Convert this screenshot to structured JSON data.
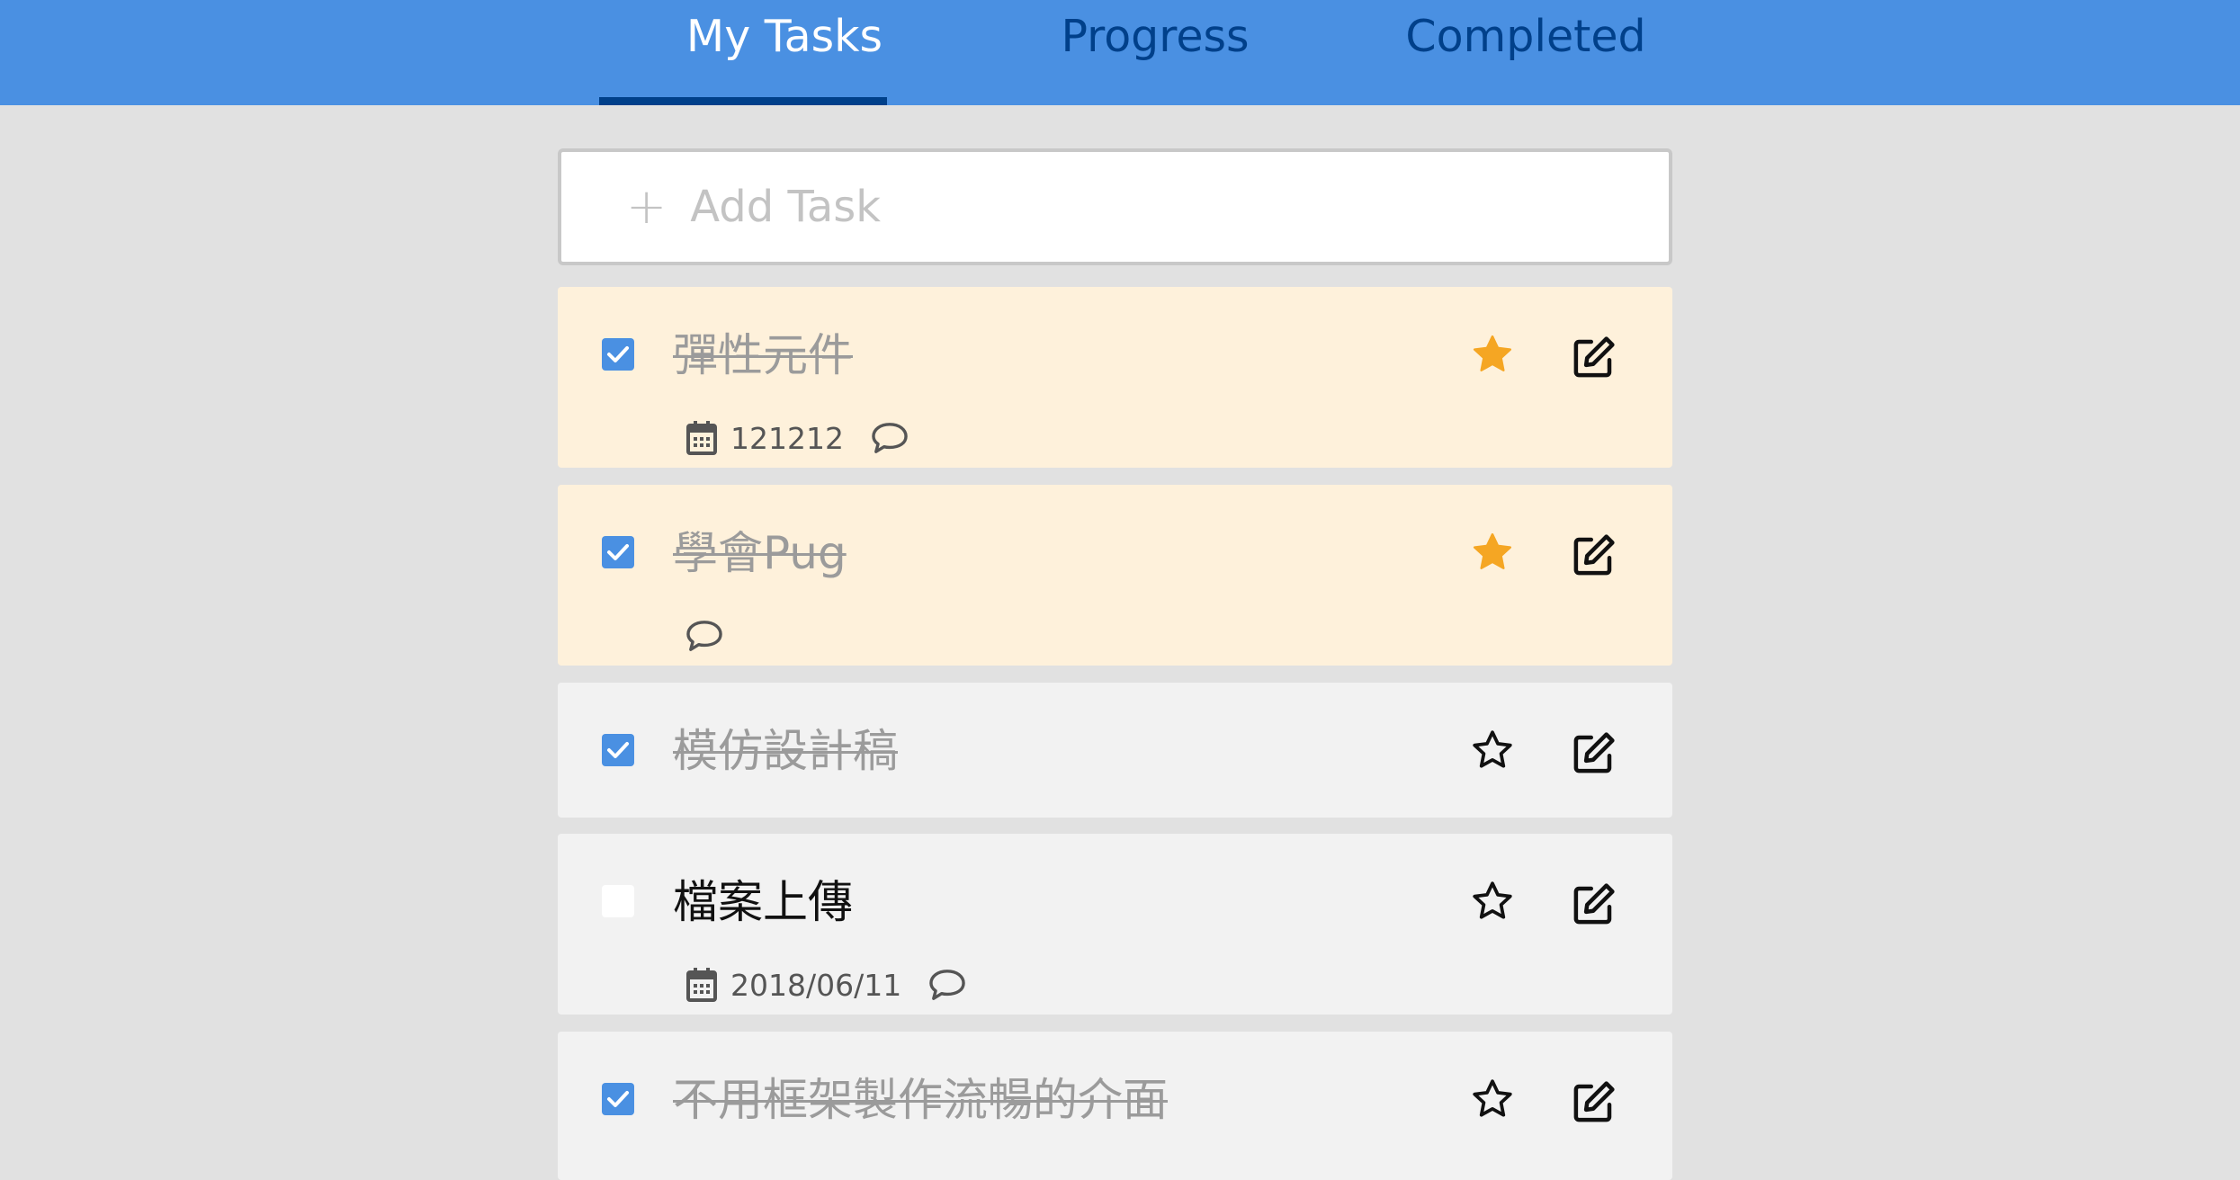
{
  "tabs": [
    {
      "label": "My Tasks",
      "active": true
    },
    {
      "label": "Progress",
      "active": false
    },
    {
      "label": "Completed",
      "active": false
    }
  ],
  "add_task": {
    "plus": "+",
    "placeholder": "Add Task"
  },
  "tasks": [
    {
      "title": "彈性元件",
      "completed": true,
      "starred": true,
      "date": "121212",
      "has_comment": true
    },
    {
      "title": "學會Pug",
      "completed": true,
      "starred": true,
      "date": "",
      "has_comment": true
    },
    {
      "title": "模仿設計稿",
      "completed": true,
      "starred": false,
      "date": "",
      "has_comment": false
    },
    {
      "title": "檔案上傳",
      "completed": false,
      "starred": false,
      "date": "2018/06/11",
      "has_comment": true
    },
    {
      "title": "不用框架製作流暢的介面",
      "completed": true,
      "starred": false,
      "date": "",
      "has_comment": false
    }
  ],
  "colors": {
    "header": "#4a90e2",
    "tab_inactive": "#00408a",
    "important_bg": "#fef1db",
    "task_bg": "#f2f2f2",
    "star_active": "#f5a623",
    "checkbox": "#4a90e2"
  },
  "icons": {
    "checkbox": "check-icon",
    "star_filled": "star-filled-icon",
    "star_outline": "star-outline-icon",
    "edit": "pencil-square-icon",
    "date": "calendar-icon",
    "comment": "comment-icon"
  }
}
